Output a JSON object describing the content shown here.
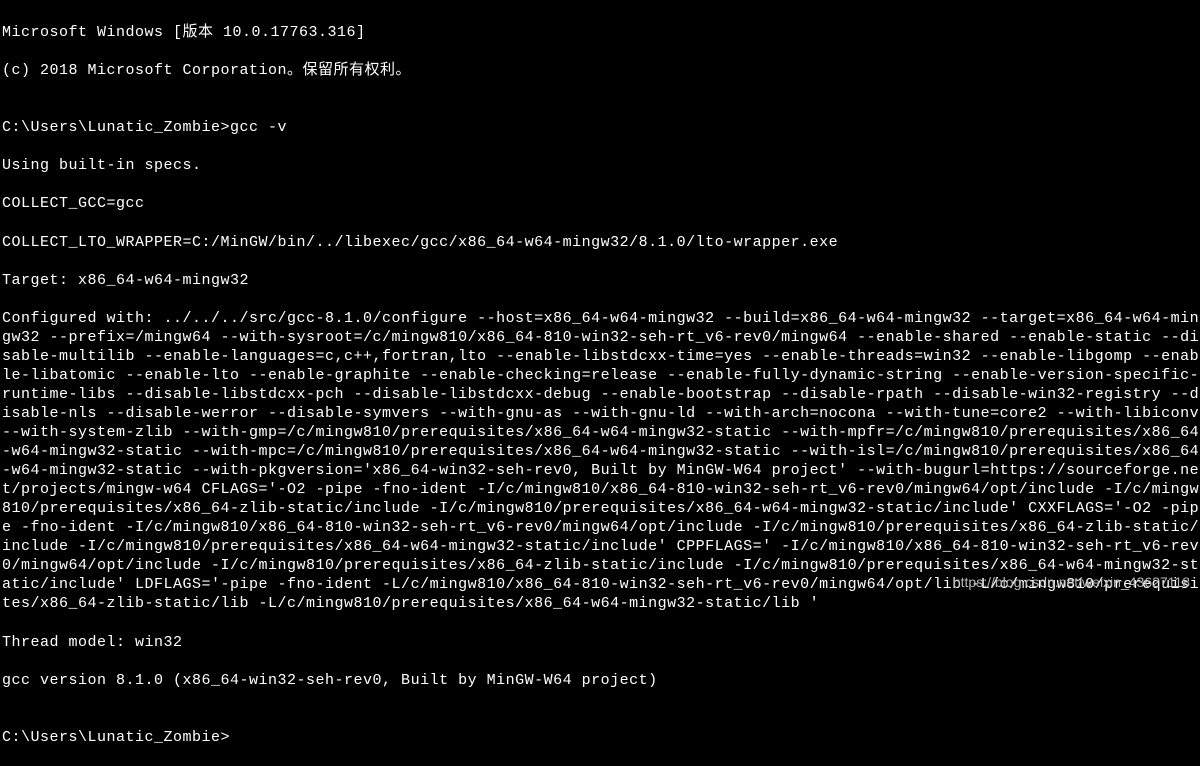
{
  "terminal": {
    "header_line1": "Microsoft Windows [版本 10.0.17763.316]",
    "header_line2": "(c) 2018 Microsoft Corporation。保留所有权利。",
    "blank": "",
    "prompt1": "C:\\Users\\Lunatic_Zombie>",
    "command1": "gcc -v",
    "out_line1": "Using built-in specs.",
    "out_line2": "COLLECT_GCC=gcc",
    "out_line3": "COLLECT_LTO_WRAPPER=C:/MinGW/bin/../libexec/gcc/x86_64-w64-mingw32/8.1.0/lto-wrapper.exe",
    "out_line4": "Target: x86_64-w64-mingw32",
    "out_configured": "Configured with: ../../../src/gcc-8.1.0/configure --host=x86_64-w64-mingw32 --build=x86_64-w64-mingw32 --target=x86_64-w64-mingw32 --prefix=/mingw64 --with-sysroot=/c/mingw810/x86_64-810-win32-seh-rt_v6-rev0/mingw64 --enable-shared --enable-static --disable-multilib --enable-languages=c,c++,fortran,lto --enable-libstdcxx-time=yes --enable-threads=win32 --enable-libgomp --enable-libatomic --enable-lto --enable-graphite --enable-checking=release --enable-fully-dynamic-string --enable-version-specific-runtime-libs --disable-libstdcxx-pch --disable-libstdcxx-debug --enable-bootstrap --disable-rpath --disable-win32-registry --disable-nls --disable-werror --disable-symvers --with-gnu-as --with-gnu-ld --with-arch=nocona --with-tune=core2 --with-libiconv --with-system-zlib --with-gmp=/c/mingw810/prerequisites/x86_64-w64-mingw32-static --with-mpfr=/c/mingw810/prerequisites/x86_64-w64-mingw32-static --with-mpc=/c/mingw810/prerequisites/x86_64-w64-mingw32-static --with-isl=/c/mingw810/prerequisites/x86_64-w64-mingw32-static --with-pkgversion='x86_64-win32-seh-rev0, Built by MinGW-W64 project' --with-bugurl=https://sourceforge.net/projects/mingw-w64 CFLAGS='-O2 -pipe -fno-ident -I/c/mingw810/x86_64-810-win32-seh-rt_v6-rev0/mingw64/opt/include -I/c/mingw810/prerequisites/x86_64-zlib-static/include -I/c/mingw810/prerequisites/x86_64-w64-mingw32-static/include' CXXFLAGS='-O2 -pipe -fno-ident -I/c/mingw810/x86_64-810-win32-seh-rt_v6-rev0/mingw64/opt/include -I/c/mingw810/prerequisites/x86_64-zlib-static/include -I/c/mingw810/prerequisites/x86_64-w64-mingw32-static/include' CPPFLAGS=' -I/c/mingw810/x86_64-810-win32-seh-rt_v6-rev0/mingw64/opt/include -I/c/mingw810/prerequisites/x86_64-zlib-static/include -I/c/mingw810/prerequisites/x86_64-w64-mingw32-static/include' LDFLAGS='-pipe -fno-ident -L/c/mingw810/x86_64-810-win32-seh-rt_v6-rev0/mingw64/opt/lib -L/c/mingw810/prerequisites/x86_64-zlib-static/lib -L/c/mingw810/prerequisites/x86_64-w64-mingw32-static/lib '",
    "out_thread": "Thread model: win32",
    "out_version": "gcc version 8.1.0 (x86_64-win32-seh-rev0, Built by MinGW-W64 project)",
    "prompt2": "C:\\Users\\Lunatic_Zombie>"
  },
  "watermark": "https://blog.csdn.net/weixin_43627118"
}
